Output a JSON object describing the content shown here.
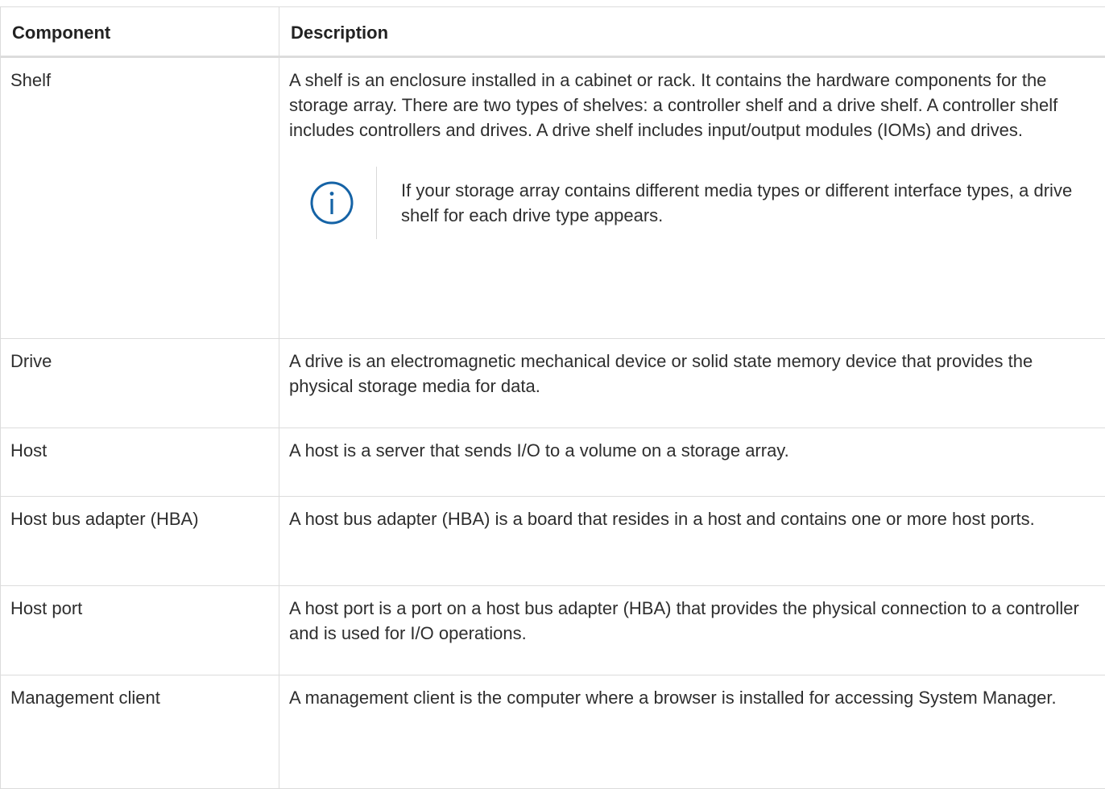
{
  "table": {
    "headers": {
      "component": "Component",
      "description": "Description"
    },
    "rows": [
      {
        "component": "Shelf",
        "description": "A shelf is an enclosure installed in a cabinet or rack. It contains the hardware components for the storage array. There are two types of shelves: a controller shelf and a drive shelf. A controller shelf includes controllers and drives. A drive shelf includes input/output modules (IOMs) and drives.",
        "note": "If your storage array contains different media types or different interface types, a drive shelf for each drive type appears."
      },
      {
        "component": "Drive",
        "description": "A drive is an electromagnetic mechanical device or solid state memory device that provides the physical storage media for data."
      },
      {
        "component": "Host",
        "description": "A host is a server that sends I/O to a volume on a storage array."
      },
      {
        "component": "Host bus adapter (HBA)",
        "description": "A host bus adapter (HBA) is a board that resides in a host and contains one or more host ports."
      },
      {
        "component": "Host port",
        "description": "A host port is a port on a host bus adapter (HBA) that provides the physical connection to a controller and is used for I/O operations."
      },
      {
        "component": "Management client",
        "description": "A management client is the computer where a browser is installed for accessing System Manager."
      }
    ]
  },
  "icons": {
    "note_icon": "info-icon",
    "note_icon_color": "#1563a6"
  }
}
